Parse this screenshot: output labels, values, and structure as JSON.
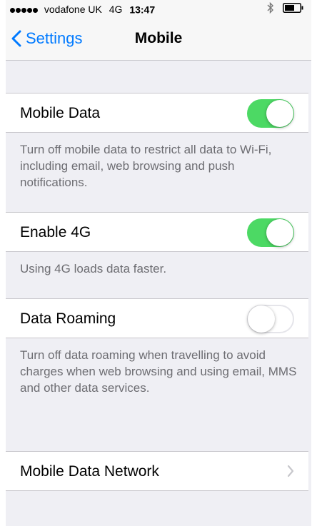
{
  "status_bar": {
    "carrier": "vodafone UK",
    "network": "4G",
    "time": "13:47",
    "signal_dots": 5,
    "icons": [
      "signal-dots-icon",
      "bluetooth-icon",
      "battery-icon"
    ]
  },
  "nav": {
    "back_label": "Settings",
    "title": "Mobile"
  },
  "settings": {
    "mobile_data": {
      "label": "Mobile Data",
      "enabled": true,
      "footer": "Turn off mobile data to restrict all data to Wi-Fi, including email, web browsing and push notifications."
    },
    "enable_4g": {
      "label": "Enable 4G",
      "enabled": true,
      "footer": "Using 4G loads data faster."
    },
    "data_roaming": {
      "label": "Data Roaming",
      "enabled": false,
      "footer": "Turn off data roaming when travelling to avoid charges when web browsing and using email, MMS and other data services."
    },
    "mobile_data_network": {
      "label": "Mobile Data Network"
    }
  },
  "colors": {
    "accent": "#007aff",
    "toggle_on": "#4cd964",
    "background": "#efeff4",
    "footer_text": "#6d6d72"
  }
}
